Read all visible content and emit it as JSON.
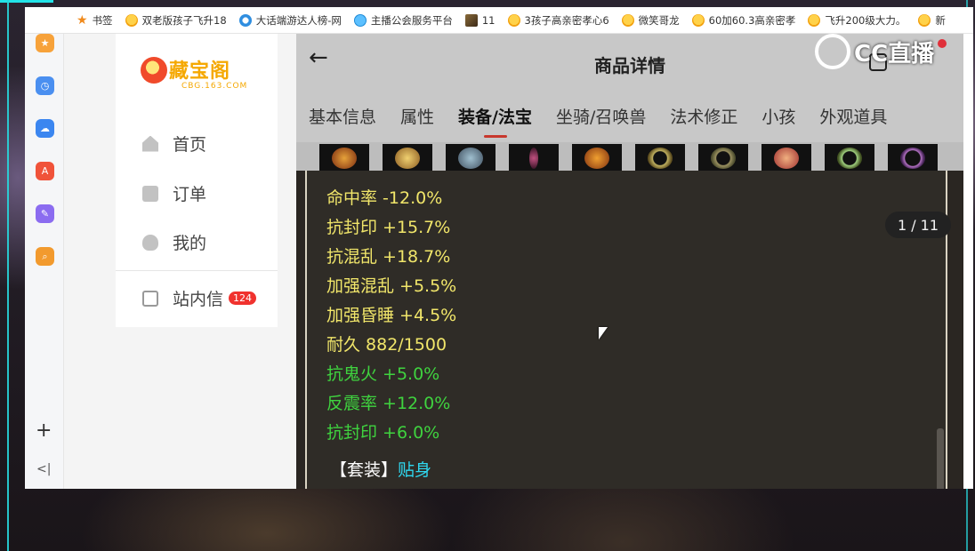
{
  "bookmarks": [
    {
      "label": "书签",
      "icon": "star-icon"
    },
    {
      "label": "双老版孩子飞升18",
      "icon": "chick-icon"
    },
    {
      "label": "大话端游达人榜-网",
      "icon": "browser-icon"
    },
    {
      "label": "主播公会服务平台",
      "icon": "cloud-icon"
    },
    {
      "label": "11",
      "icon": "game-icon"
    },
    {
      "label": "3孩子高亲密孝心6",
      "icon": "chick-icon"
    },
    {
      "label": "微笑哥龙",
      "icon": "chick-icon"
    },
    {
      "label": "60加60.3高亲密孝",
      "icon": "chick-icon"
    },
    {
      "label": "飞升200级大力。",
      "icon": "chick-icon"
    },
    {
      "label": "新",
      "icon": "chick-icon"
    }
  ],
  "site": {
    "logo_title": "藏宝阁",
    "logo_sub": "CBG.163.COM",
    "nav": {
      "home": "首页",
      "orders": "订单",
      "mine": "我的",
      "messages": "站内信",
      "messages_badge": "124"
    }
  },
  "detail": {
    "title": "商品详情",
    "tabs": [
      "基本信息",
      "属性",
      "装备/法宝",
      "坐骑/召唤兽",
      "法术修正",
      "小孩",
      "外观道具"
    ],
    "active_tab_index": 2,
    "pager": "1 / 11",
    "stats_yellow": [
      "命中率 -12.0%",
      "抗封印 +15.7%",
      "抗混乱 +18.7%",
      "加强混乱 +5.5%",
      "加强昏睡 +4.5%",
      "耐久 882/1500"
    ],
    "stats_green": [
      "抗鬼火 +5.0%",
      "反震率 +12.0%",
      "抗封印 +6.0%"
    ],
    "suit_prefix": "【套装】",
    "suit_link": "贴身"
  },
  "watermark": {
    "text": "CC直播"
  },
  "colors": {
    "stat_yellow": "#f1e66a",
    "stat_green": "#3fd33f",
    "suit_link": "#2fd8f0",
    "badge": "#f0322e",
    "brand_gold": "#f5a800"
  }
}
